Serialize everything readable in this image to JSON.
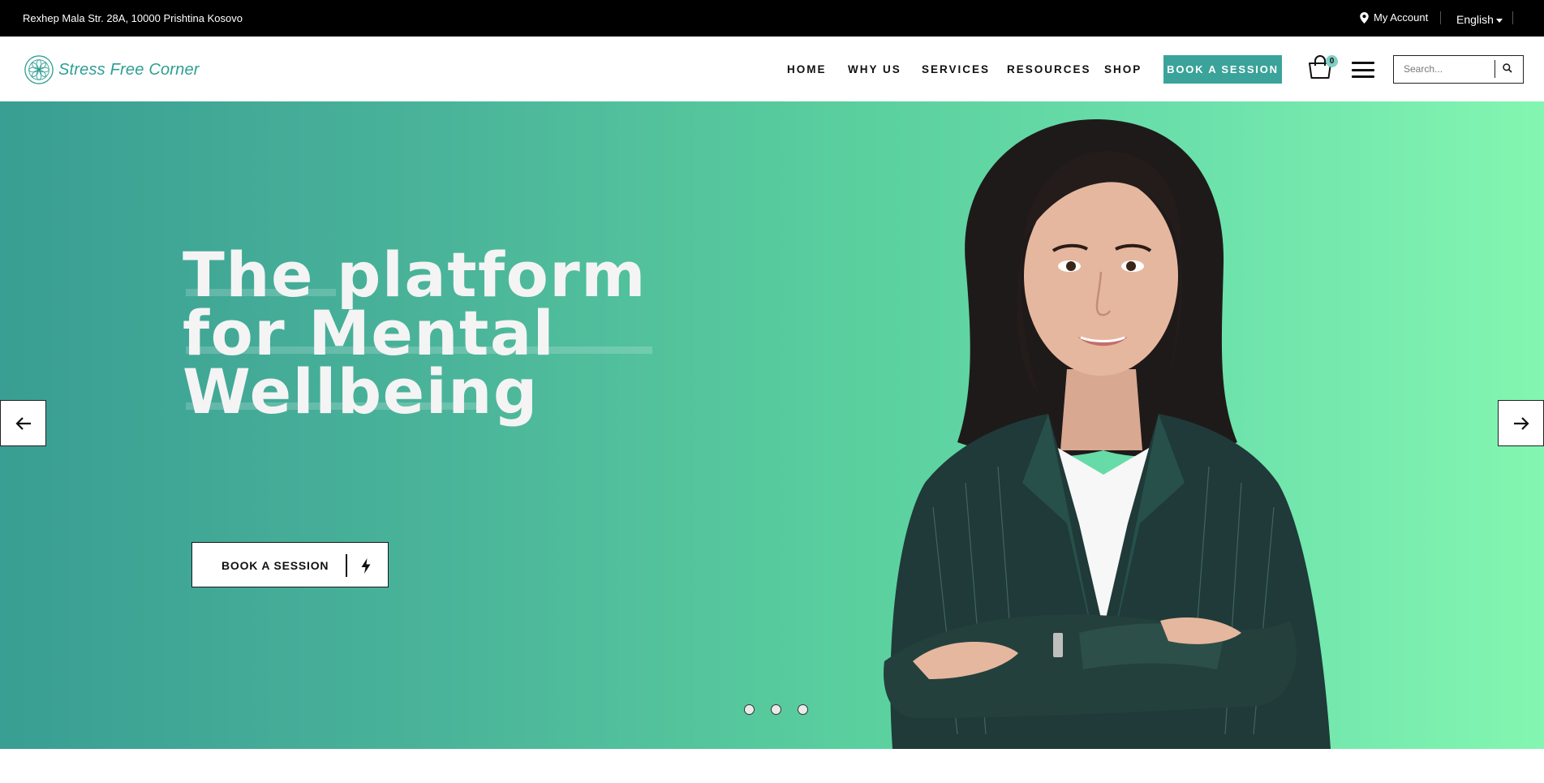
{
  "topbar": {
    "address": "Rexhep Mala Str. 28A, 10000 Prishtina Kosovo",
    "account_label": "My Account",
    "language": "English"
  },
  "header": {
    "logo_text": "Stress Free Corner",
    "nav": [
      {
        "label": "HOME",
        "active": true
      },
      {
        "label": "WHY US"
      },
      {
        "label": "SERVICES"
      },
      {
        "label": "RESOURCES"
      },
      {
        "label": "SHOP"
      }
    ],
    "book_button": "BOOK A SESSION",
    "cart_count": "0",
    "search_placeholder": "Search..."
  },
  "hero": {
    "title_line1": "The platform",
    "title_line2": "for Mental",
    "title_line3": "Wellbeing",
    "cta_label": "BOOK A SESSION",
    "slides": 3,
    "colors": {
      "gradient_start": "#399e93",
      "gradient_end": "#83f6b1",
      "accent": "#3aa39a"
    }
  },
  "icons": [
    "location-pin-icon",
    "caret-down-icon",
    "logo-mandala-icon",
    "cart-icon",
    "hamburger-icon",
    "search-icon",
    "bolt-icon",
    "arrow-left-icon",
    "arrow-right-icon"
  ]
}
